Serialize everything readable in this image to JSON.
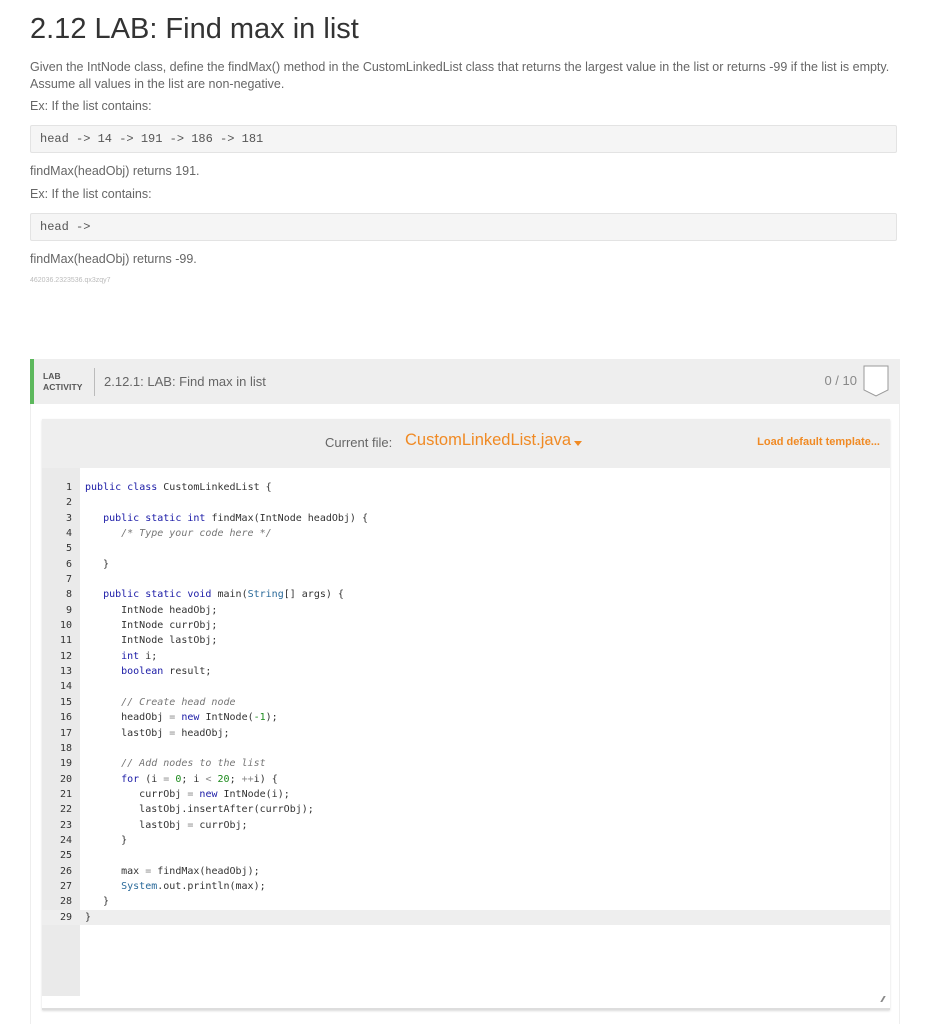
{
  "page": {
    "title": "2.12 LAB: Find max in list",
    "intro": "Given the IntNode class, define the findMax() method in the CustomLinkedList class that returns the largest value in the list or returns -99 if the list is empty. Assume all values in the list are non-negative.",
    "example1_label": "Ex: If the list contains:",
    "example1_code": "head -> 14 -> 191 -> 186 -> 181",
    "example1_result": "findMax(headObj) returns 191.",
    "example2_label": "Ex: If the list contains:",
    "example2_code": "head ->",
    "example2_result": "findMax(headObj) returns -99.",
    "content_id": "462036.2323536.qx3zqy7"
  },
  "lab": {
    "tag_line1": "LAB",
    "tag_line2": "ACTIVITY",
    "name": "2.12.1: LAB: Find max in list",
    "score": "0 / 10",
    "accent_color": "#5cb85c"
  },
  "editor": {
    "current_file_label": "Current file:",
    "current_file": "CustomLinkedList.java",
    "load_default": "Load default template...",
    "accent_color": "#f08a24",
    "active_line": 29,
    "lines": [
      "public class CustomLinkedList {",
      "",
      "   public static int findMax(IntNode headObj) {",
      "      /* Type your code here */",
      "",
      "   }",
      "",
      "   public static void main(String[] args) {",
      "      IntNode headObj;",
      "      IntNode currObj;",
      "      IntNode lastObj;",
      "      int i;",
      "      boolean result;",
      "",
      "      // Create head node",
      "      headObj = new IntNode(-1);",
      "      lastObj = headObj;",
      "",
      "      // Add nodes to the list",
      "      for (i = 0; i < 20; ++i) {",
      "         currObj = new IntNode(i);",
      "         lastObj.insertAfter(currObj);",
      "         lastObj = currObj;",
      "      }",
      "",
      "      max = findMax(headObj);",
      "      System.out.println(max);",
      "   }",
      "}"
    ]
  }
}
